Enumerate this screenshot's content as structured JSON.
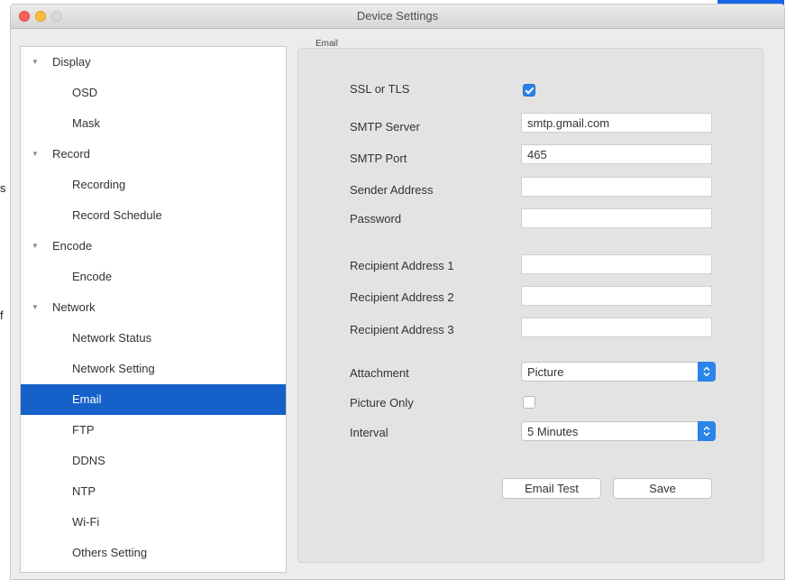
{
  "window": {
    "title": "Device Settings"
  },
  "edge_marks": [
    "s",
    "f"
  ],
  "sidebar": {
    "items": [
      {
        "label": "Display",
        "kind": "parent",
        "expanded": true
      },
      {
        "label": "OSD",
        "kind": "child"
      },
      {
        "label": "Mask",
        "kind": "child"
      },
      {
        "label": "Record",
        "kind": "parent",
        "expanded": true
      },
      {
        "label": "Recording",
        "kind": "child"
      },
      {
        "label": "Record Schedule",
        "kind": "child"
      },
      {
        "label": "Encode",
        "kind": "parent",
        "expanded": true
      },
      {
        "label": "Encode",
        "kind": "child"
      },
      {
        "label": "Network",
        "kind": "parent",
        "expanded": true
      },
      {
        "label": "Network Status",
        "kind": "child"
      },
      {
        "label": "Network Setting",
        "kind": "child"
      },
      {
        "label": "Email",
        "kind": "child",
        "selected": true
      },
      {
        "label": "FTP",
        "kind": "child"
      },
      {
        "label": "DDNS",
        "kind": "child"
      },
      {
        "label": "NTP",
        "kind": "child"
      },
      {
        "label": "Wi-Fi",
        "kind": "child"
      },
      {
        "label": "Others Setting",
        "kind": "child"
      }
    ]
  },
  "email": {
    "group_label": "Email",
    "ssl_label": "SSL or TLS",
    "ssl_checked": true,
    "smtp_server_label": "SMTP Server",
    "smtp_server_value": "smtp.gmail.com",
    "smtp_port_label": "SMTP Port",
    "smtp_port_value": "465",
    "sender_label": "Sender Address",
    "sender_value": "",
    "password_label": "Password",
    "password_value": "",
    "recipient1_label": "Recipient Address 1",
    "recipient1_value": "",
    "recipient2_label": "Recipient Address 2",
    "recipient2_value": "",
    "recipient3_label": "Recipient Address 3",
    "recipient3_value": "",
    "attachment_label": "Attachment",
    "attachment_value": "Picture",
    "picture_only_label": "Picture Only",
    "picture_only_checked": false,
    "interval_label": "Interval",
    "interval_value": "5 Minutes",
    "email_test_label": "Email Test",
    "save_label": "Save"
  },
  "colors": {
    "selection": "#1560c9",
    "accent": "#2b84ea",
    "panel": "#e3e3e3",
    "window": "#ececec"
  }
}
